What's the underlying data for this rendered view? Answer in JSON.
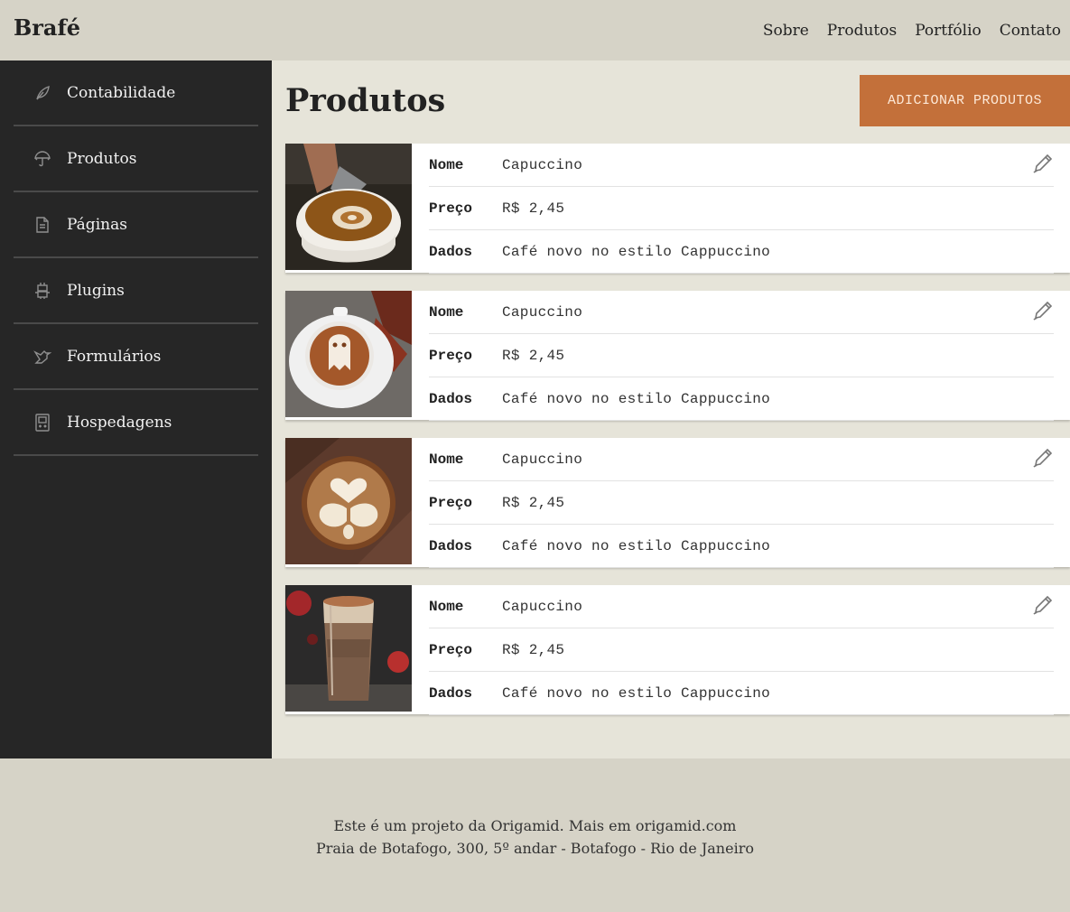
{
  "header": {
    "logo": "Brafé",
    "nav": [
      "Sobre",
      "Produtos",
      "Portfólio",
      "Contato"
    ]
  },
  "sidebar": {
    "items": [
      {
        "label": "Contabilidade",
        "icon": "leaf-icon"
      },
      {
        "label": "Produtos",
        "icon": "umbrella-icon"
      },
      {
        "label": "Páginas",
        "icon": "document-icon"
      },
      {
        "label": "Plugins",
        "icon": "robot-icon"
      },
      {
        "label": "Formulários",
        "icon": "bird-icon"
      },
      {
        "label": "Hospedagens",
        "icon": "gameboy-icon"
      }
    ]
  },
  "main": {
    "title": "Produtos",
    "add_button": "ADICIONAR PRODUTOS",
    "field_labels": {
      "name": "Nome",
      "price": "Preço",
      "data": "Dados"
    },
    "products": [
      {
        "name": "Capuccino",
        "price": "R$ 2,45",
        "data": "Café novo no estilo Cappuccino",
        "image": "latte-art-pour-photo"
      },
      {
        "name": "Capuccino",
        "price": "R$ 2,45",
        "data": "Café novo no estilo Cappuccino",
        "image": "ghost-latte-art-photo"
      },
      {
        "name": "Capuccino",
        "price": "R$ 2,45",
        "data": "Café novo no estilo Cappuccino",
        "image": "heart-wings-latte-art-photo"
      },
      {
        "name": "Capuccino",
        "price": "R$ 2,45",
        "data": "Café novo no estilo Cappuccino",
        "image": "glass-cappuccino-photo"
      }
    ]
  },
  "footer": {
    "line1": "Este é um projeto da Origamid. Mais em origamid.com",
    "line2": "Praia de Botafogo, 300, 5º andar - Botafogo - Rio de Janeiro"
  },
  "colors": {
    "accent": "#c3703a",
    "sidebar": "#262626",
    "header": "#d6d3c7",
    "background": "#e6e4d9"
  }
}
